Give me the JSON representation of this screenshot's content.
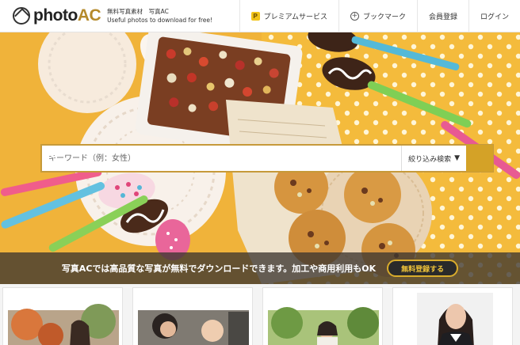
{
  "header": {
    "logo_text": "photo",
    "logo_accent": "AC",
    "tagline_1": "無料写真素材　写真AC",
    "tagline_2": "Useful photos to download for free!"
  },
  "nav": {
    "premium": "プレミアムサービス",
    "premium_icon": "P",
    "bookmark": "ブックマーク",
    "bookmark_icon": "+",
    "register": "会員登録",
    "login": "ログイン"
  },
  "search": {
    "placeholder": "キーワード（例：女性）",
    "filter_label": "絞り込み検索",
    "filter_arrow": "▼"
  },
  "banner": {
    "text": "写真ACでは高品質な写真が無料でダウンロードできます。加工や商用利用もOK",
    "button": "無料登録する"
  },
  "colors": {
    "accent": "#d4a227",
    "logo_accent": "#b58a2b",
    "banner_bg": "#3c3630"
  }
}
